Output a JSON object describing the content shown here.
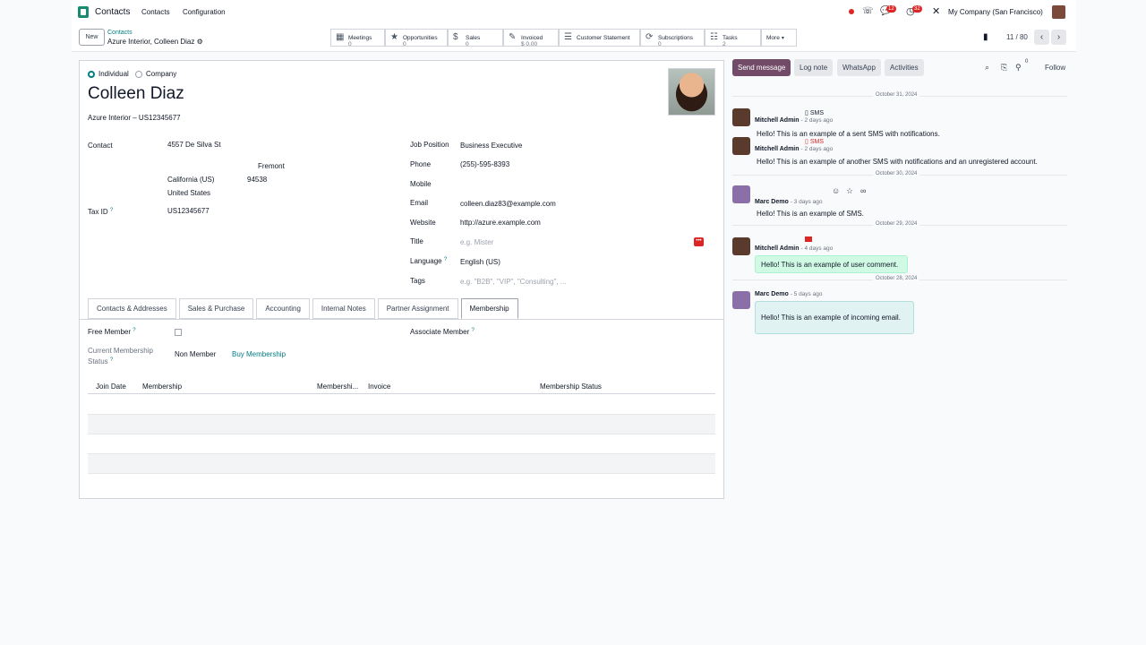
{
  "navbar": {
    "app_name": "Contacts",
    "menu": [
      "Contacts",
      "Configuration"
    ],
    "badges": {
      "messages": "12",
      "activities": "32"
    },
    "company": "My Company (San Francisco)"
  },
  "control": {
    "new_label": "New",
    "breadcrumb_parent": "Contacts",
    "breadcrumb_current": "Azure Interior, Colleen Diaz",
    "smart_buttons": [
      {
        "label": "Meetings",
        "value": "0",
        "icon": "calendar-icon"
      },
      {
        "label": "Opportunities",
        "value": "0",
        "icon": "star-icon"
      },
      {
        "label": "Sales",
        "value": "0",
        "icon": "dollar-icon"
      },
      {
        "label": "Invoiced",
        "value": "$ 0.00",
        "icon": "invoice-icon"
      },
      {
        "label": "Customer Statement",
        "value": "",
        "icon": "list-icon"
      },
      {
        "label": "Subscriptions",
        "value": "0",
        "icon": "refresh-icon"
      },
      {
        "label": "Tasks",
        "value": "2",
        "icon": "tasks-icon"
      },
      {
        "label": "More",
        "value": "",
        "icon": "chevron-down-icon"
      }
    ],
    "pager": "11 / 80"
  },
  "form": {
    "type_individual": "Individual",
    "type_company": "Company",
    "name": "Colleen Diaz",
    "company_line": "Azure Interior – US12345677",
    "labels": {
      "contact": "Contact",
      "tax_id": "Tax ID",
      "job_position": "Job Position",
      "phone": "Phone",
      "mobile": "Mobile",
      "email": "Email",
      "website": "Website",
      "title": "Title",
      "language": "Language",
      "tags": "Tags"
    },
    "values": {
      "street": "4557 De Silva St",
      "city": "Fremont",
      "state": "California (US)",
      "zip": "94538",
      "country": "United States",
      "tax_id": "US12345677",
      "job_position": "Business Executive",
      "phone": "(255)-595-8393",
      "email": "colleen.diaz83@example.com",
      "website": "http://azure.example.com",
      "language": "English (US)"
    },
    "placeholders": {
      "title": "e.g. Mister",
      "tags": "e.g. \"B2B\", \"VIP\", \"Consulting\", ..."
    },
    "tabs": [
      "Contacts & Addresses",
      "Sales & Purchase",
      "Accounting",
      "Internal Notes",
      "Partner Assignment",
      "Membership"
    ],
    "membership": {
      "free_member": "Free Member",
      "associate_member": "Associate Member",
      "current_status_label_1": "Current Membership",
      "current_status_label_2": "Status",
      "current_status": "Non Member",
      "buy_link": "Buy Membership",
      "columns": [
        "Join Date",
        "Membership",
        "Membershi...",
        "Invoice",
        "Membership Status"
      ]
    }
  },
  "chatter": {
    "buttons": {
      "send": "Send message",
      "log": "Log note",
      "whatsapp": "WhatsApp",
      "activities": "Activities",
      "follow": "Follow"
    },
    "follower_count": "0",
    "dates": [
      "October 31, 2024",
      "October 30, 2024",
      "October 29, 2024",
      "October 28, 2024"
    ],
    "messages": [
      {
        "author": "Mitchell Admin",
        "ago": "- 2 days ago",
        "tag": "SMS",
        "body": "Hello! This is an example of a sent SMS with notifications."
      },
      {
        "author": "Mitchell Admin",
        "ago": "- 2 days ago",
        "tag": "SMS",
        "body": "Hello! This is an example of another SMS with notifications and an unregistered account."
      },
      {
        "author": "Marc Demo",
        "ago": "- 3 days ago",
        "tag": "",
        "body": "Hello! This is an example of SMS."
      },
      {
        "author": "Mitchell Admin",
        "ago": "- 4 days ago",
        "tag": "",
        "body": "Hello! This is an example of user comment."
      },
      {
        "author": "Marc Demo",
        "ago": "- 5 days ago",
        "tag": "",
        "body": "Hello! This is an example of incoming email."
      }
    ]
  }
}
